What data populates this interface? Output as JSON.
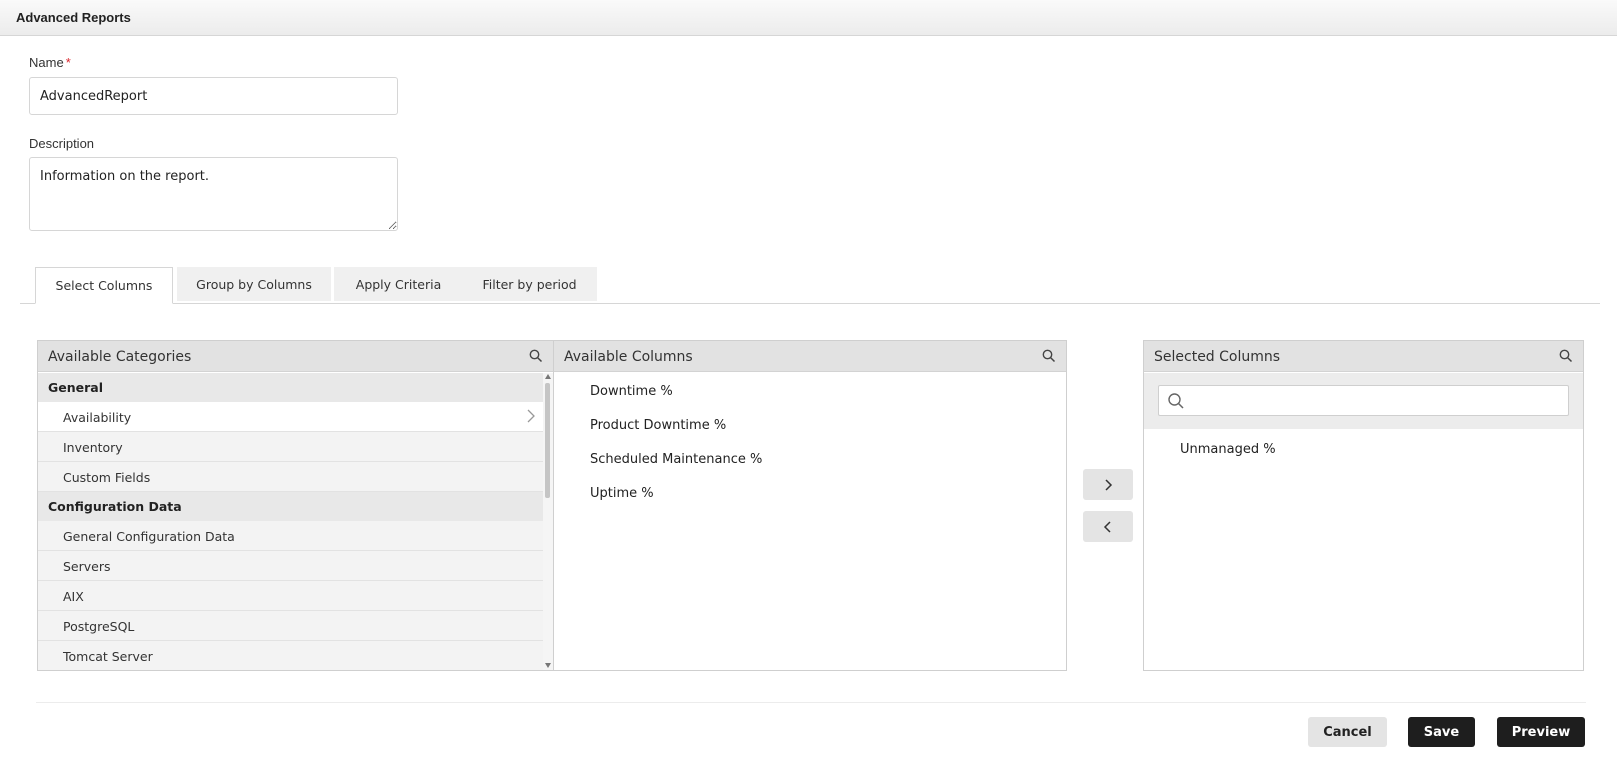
{
  "header": {
    "title": "Advanced Reports"
  },
  "form": {
    "name_label": "Name",
    "name_required_mark": "*",
    "name_value": "AdvancedReport",
    "description_label": "Description",
    "description_value": "Information on the report."
  },
  "tabs": [
    {
      "label": "Select Columns",
      "active": true
    },
    {
      "label": "Group by Columns",
      "active": false
    },
    {
      "label": "Apply Criteria",
      "active": false
    },
    {
      "label": "Filter by period",
      "active": false
    }
  ],
  "categories_panel": {
    "title": "Available Categories",
    "groups": [
      {
        "label": "General",
        "items": [
          "Availability",
          "Inventory",
          "Custom Fields"
        ]
      },
      {
        "label": "Configuration Data",
        "items": [
          "General Configuration Data",
          "Servers",
          "AIX",
          "PostgreSQL",
          "Tomcat Server"
        ]
      }
    ],
    "selected_item": "Availability"
  },
  "columns_panel": {
    "title": "Available Columns",
    "items": [
      "Downtime %",
      "Product Downtime %",
      "Scheduled Maintenance %",
      "Uptime %"
    ]
  },
  "selected_panel": {
    "title": "Selected Columns",
    "search_placeholder": "",
    "items": [
      "Unmanaged %"
    ]
  },
  "move": {
    "add_glyph": "›",
    "remove_glyph": "‹"
  },
  "actions": {
    "cancel": "Cancel",
    "save": "Save",
    "preview": "Preview"
  },
  "colors": {
    "primary_button": "#1e1e1e",
    "secondary_button": "#e4e4e4",
    "required": "#d9252c"
  }
}
